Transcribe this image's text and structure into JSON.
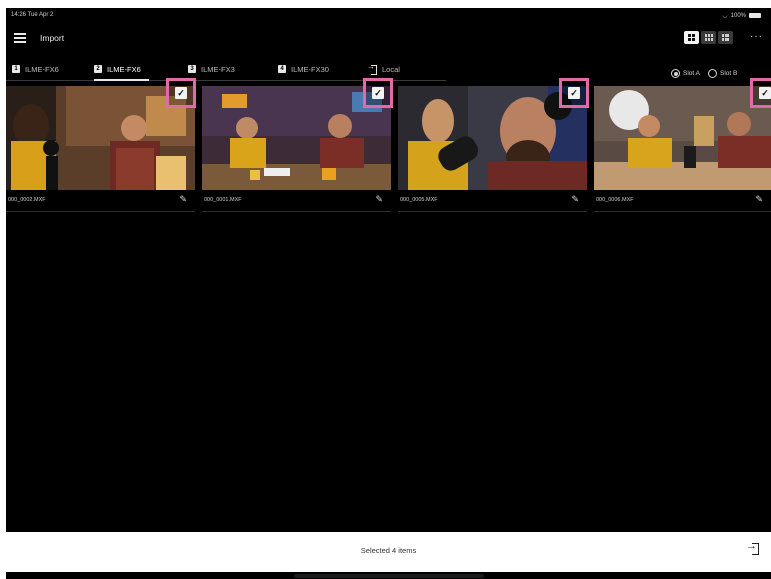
{
  "status_bar": {
    "time": "14:26 Tue Apr 2",
    "battery": "100%"
  },
  "header": {
    "title": "Import",
    "more": "···"
  },
  "view_modes": [
    "grid-large",
    "grid-small",
    "list"
  ],
  "tabs": [
    {
      "num": "1",
      "label": "ILME-FX6",
      "active": false
    },
    {
      "num": "2",
      "label": "ILME-FX6",
      "active": true
    },
    {
      "num": "3",
      "label": "ILME-FX3",
      "active": false
    },
    {
      "num": "4",
      "label": "ILME-FX30",
      "active": false
    },
    {
      "label": "Local",
      "icon": "import-icon"
    }
  ],
  "slots": {
    "a": "Slot A",
    "b": "Slot B",
    "selected": "a"
  },
  "clips": [
    {
      "name": "000_0002.MXF",
      "checked": true
    },
    {
      "name": "000_0001.MXF",
      "checked": true
    },
    {
      "name": "000_0005.MXF",
      "checked": true
    },
    {
      "name": "000_0006.MXF",
      "checked": true
    }
  ],
  "bottom": {
    "selected_text": "Selected 4 items"
  },
  "colors": {
    "highlight": "#e26aa8",
    "background": "#000000"
  }
}
